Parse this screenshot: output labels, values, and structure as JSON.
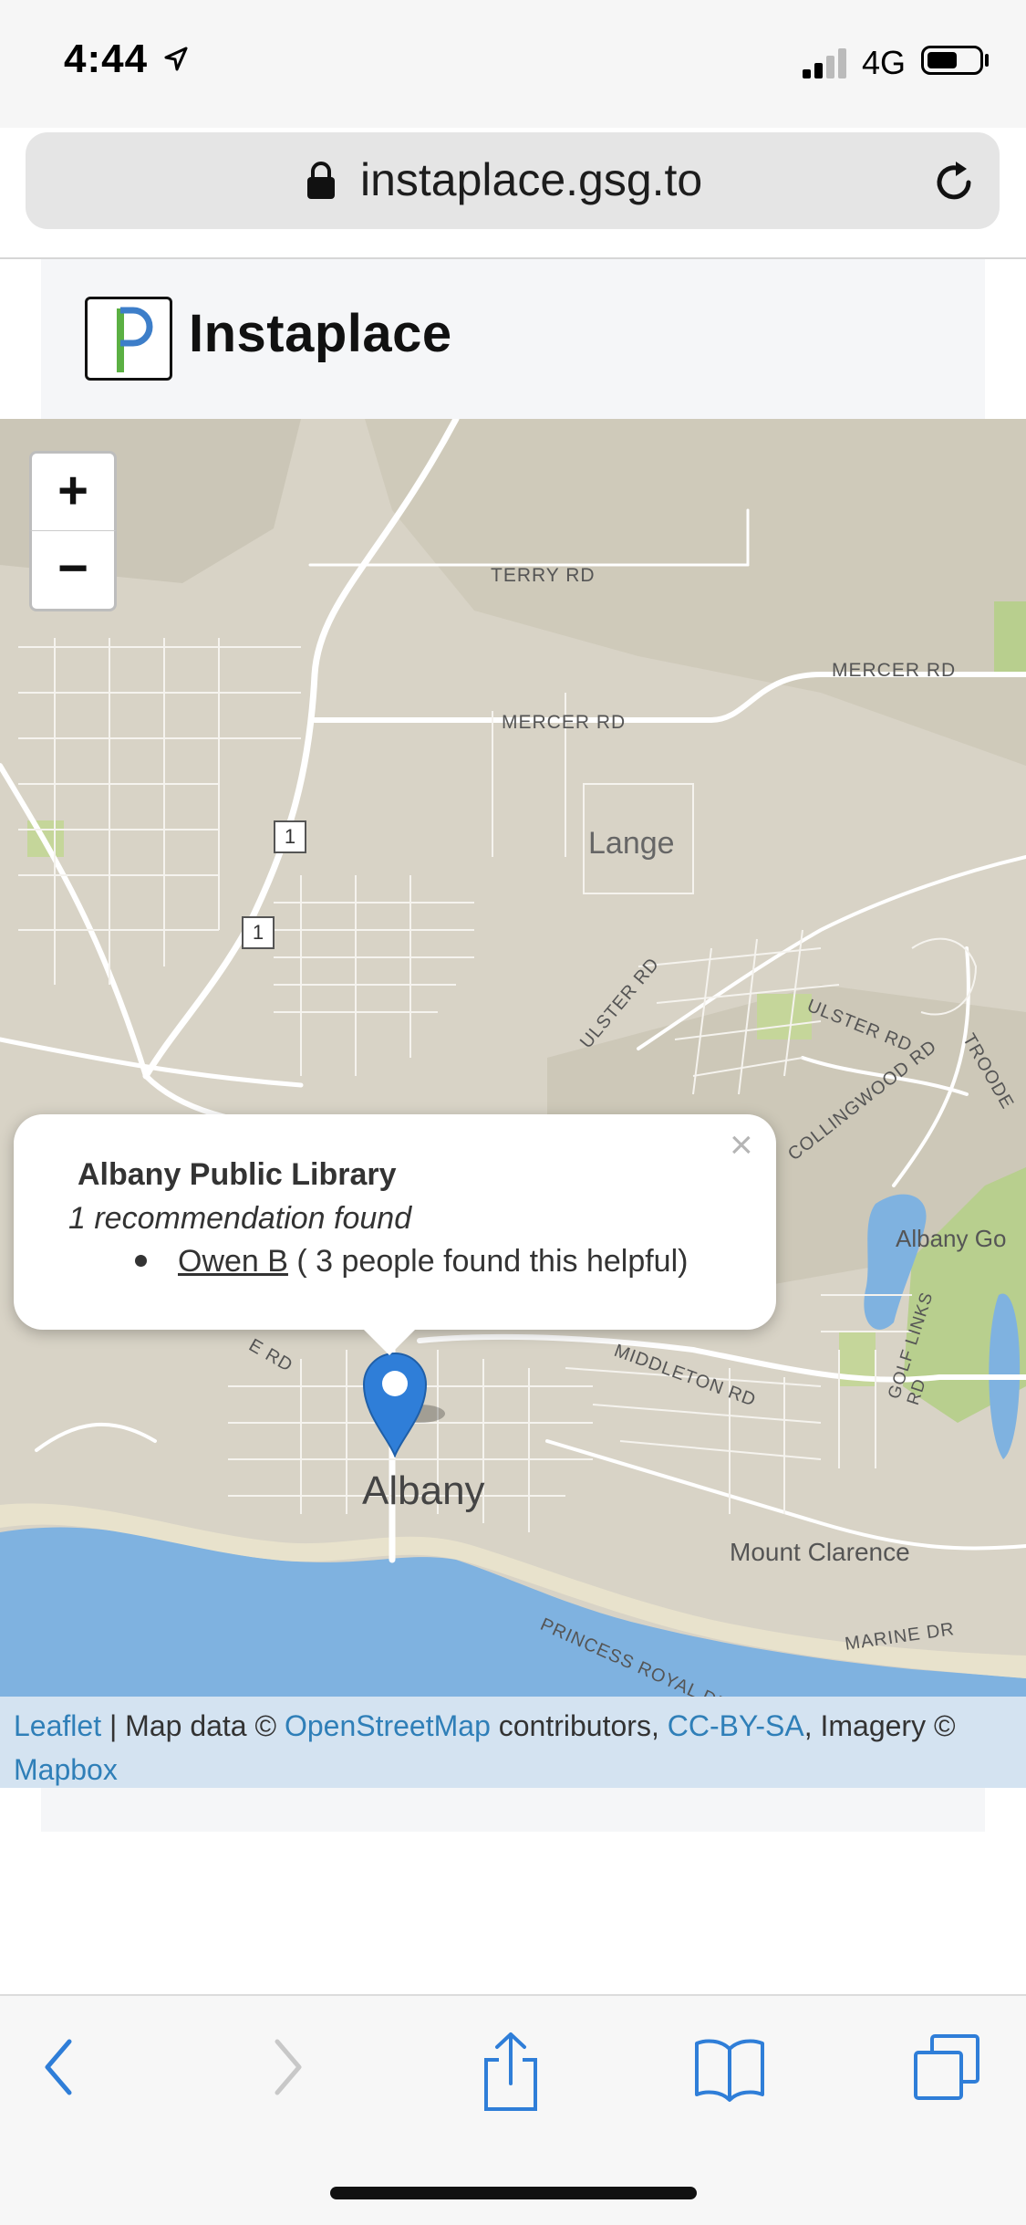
{
  "status_bar": {
    "time": "4:44",
    "network": "4G"
  },
  "browser": {
    "url": "instaplace.gsg.to"
  },
  "site": {
    "brand": "Instaplace",
    "logo_letter": "P"
  },
  "map": {
    "labels": {
      "terry_rd": "TERRY RD",
      "mercer_rd_1": "MERCER RD",
      "mercer_rd_2": "MERCER RD",
      "lange": "Lange",
      "route_1a": "1",
      "route_1b": "1",
      "ulster_rd_1": "ULSTER RD",
      "ulster_rd_2": "ULSTER RD",
      "collingwood_rd": "COLLINGWOOD RD",
      "troode": "TROODE",
      "albany_golf": "Albany Go",
      "golf_links_rd": "GOLF LINKS RD",
      "middleton_rd": "MIDDLETON RD",
      "albany": "Albany",
      "mount_clarence": "Mount Clarence",
      "marine_dr": "MARINE DR",
      "princess_royal": "PRINCESS ROYAL DR",
      "e_rd": "E RD"
    },
    "zoom_in": "+",
    "zoom_out": "−",
    "popup": {
      "close": "×",
      "title": "Albany Public Library",
      "subtitle": "1 recommendation found",
      "recommender": "Owen B",
      "helpful": " ( 3 people found this helpful)"
    },
    "attribution": {
      "leaflet": "Leaflet",
      "sep1": " | Map data © ",
      "osm": "OpenStreetMap",
      "contrib": " contributors, ",
      "license": "CC-BY-SA",
      "imagery": ", Imagery © ",
      "mapbox": "Mapbox"
    },
    "colors": {
      "land": "#d8d3c6",
      "water": "#7fb2e0",
      "park": "#b8cf8e",
      "road": "#ffffff",
      "pin": "#2f7ed8"
    }
  }
}
